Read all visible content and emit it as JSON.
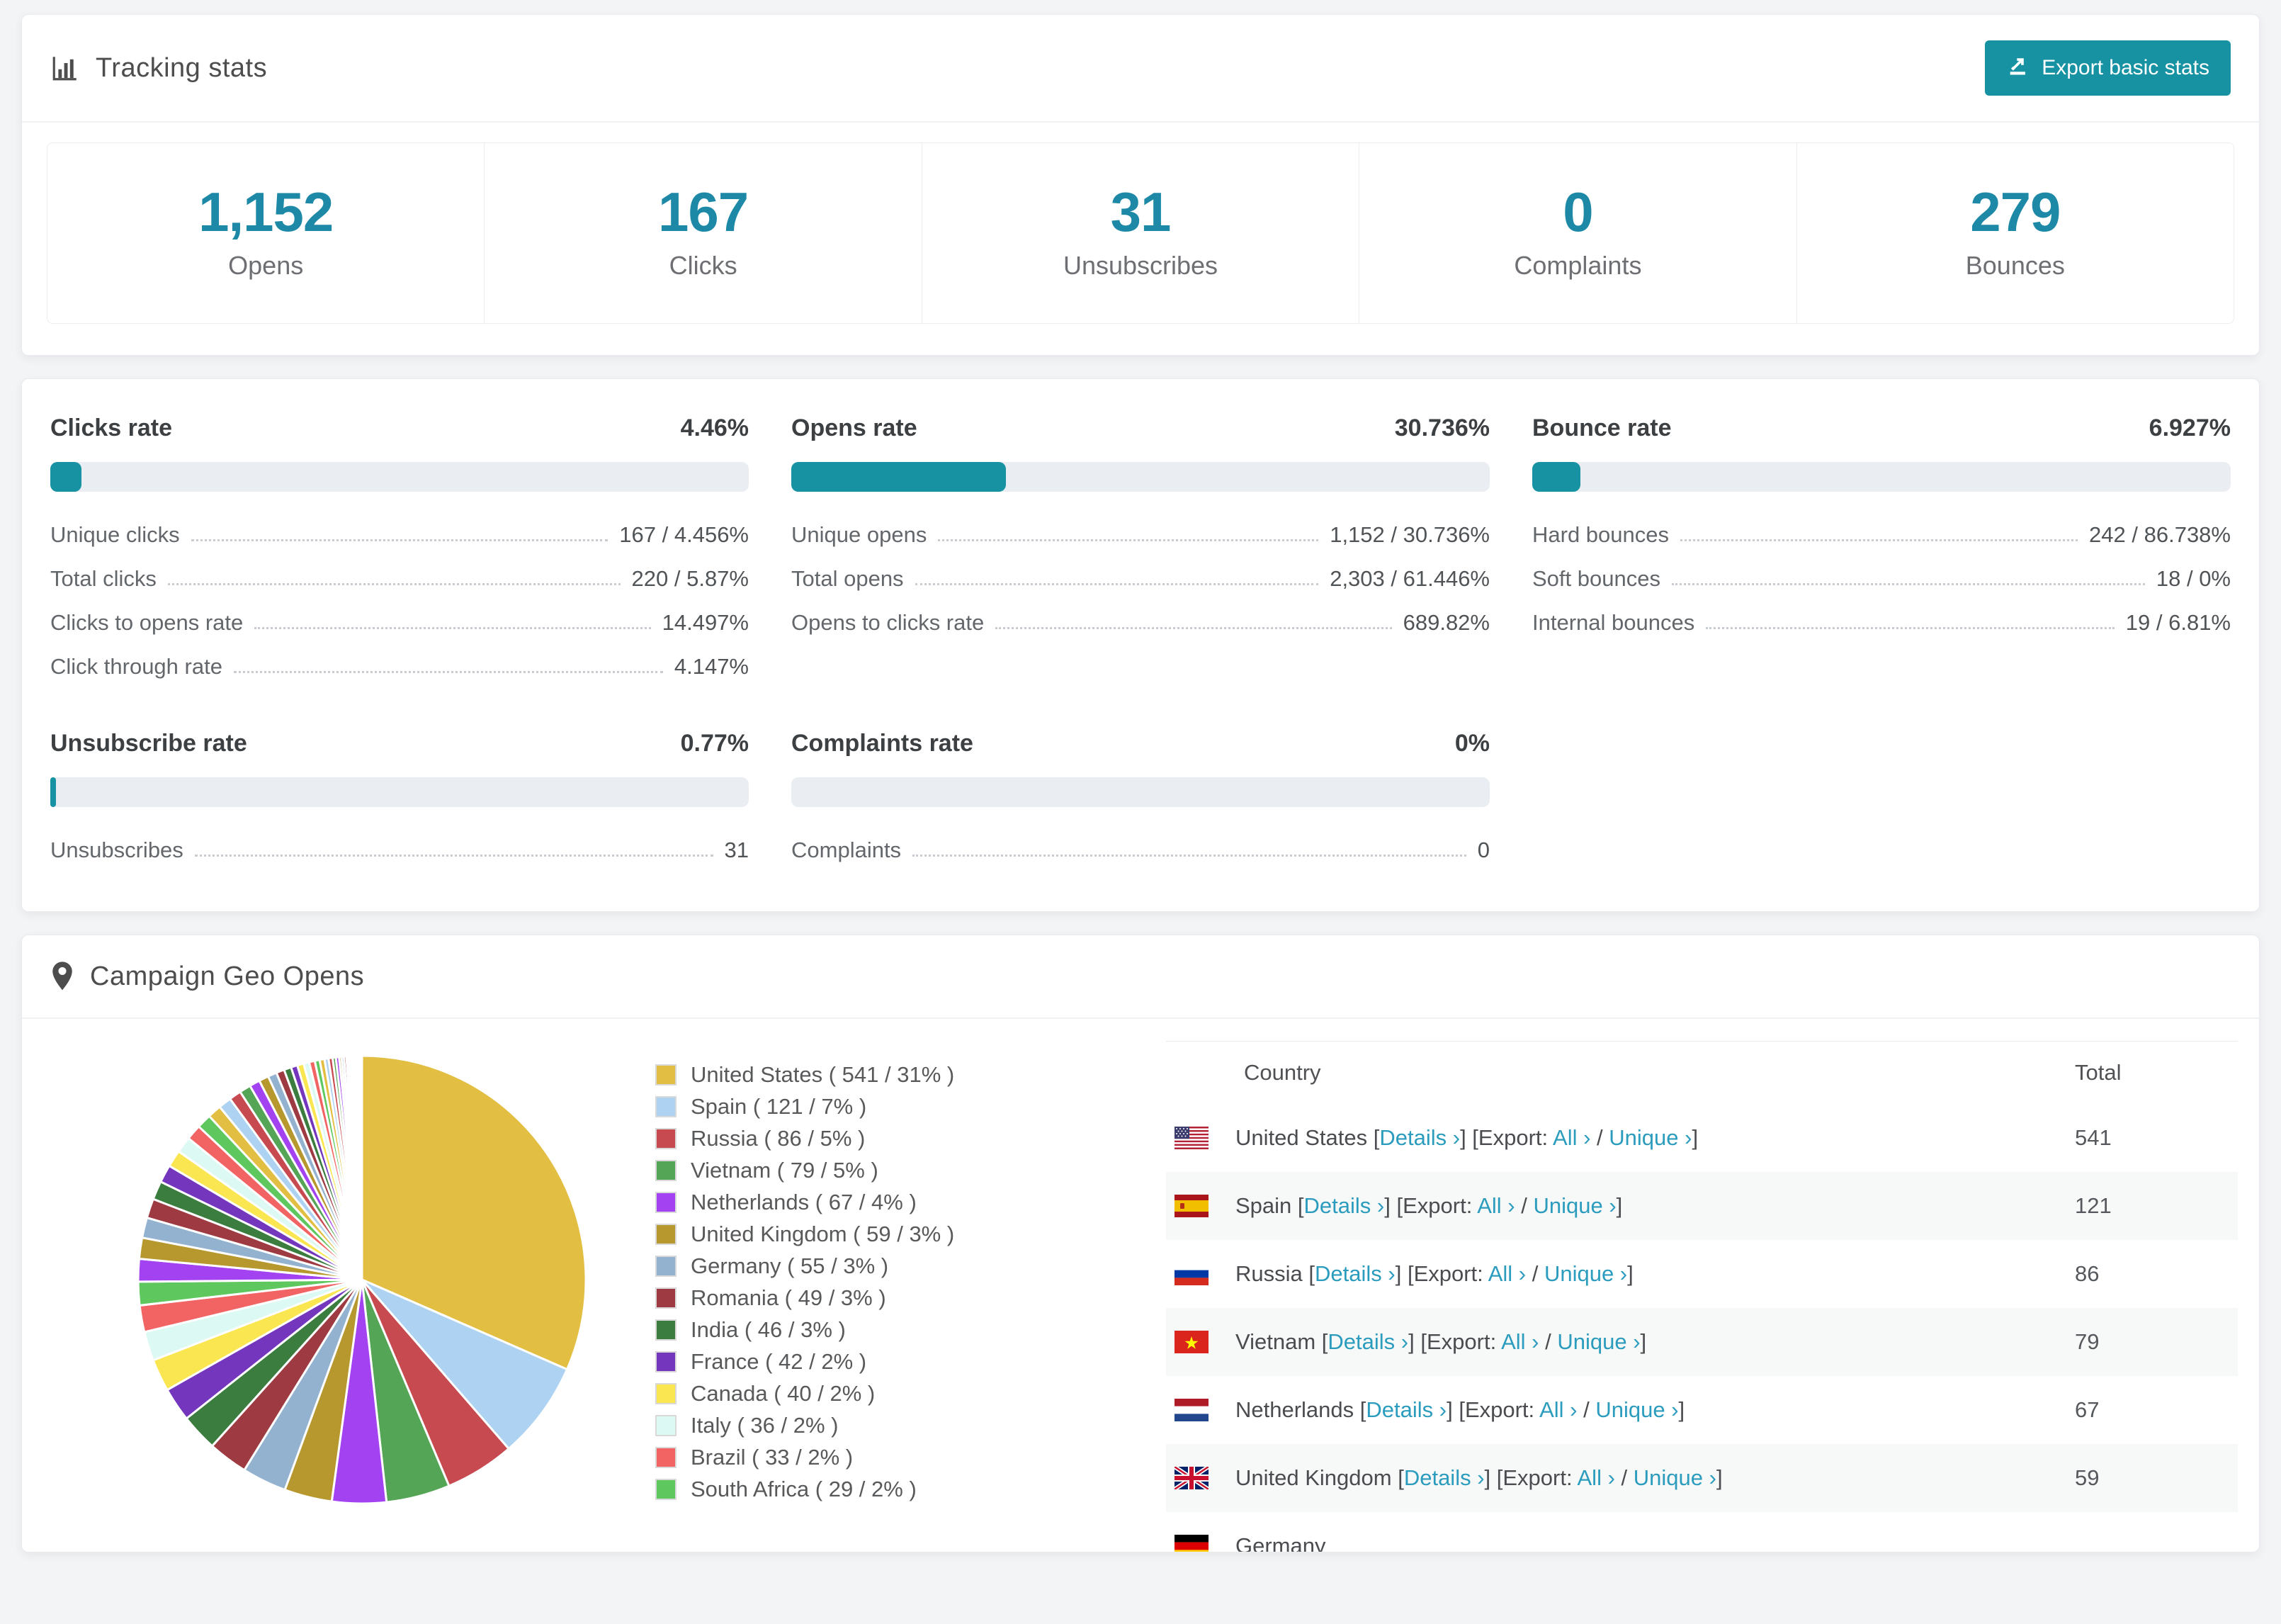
{
  "colors": {
    "accent": "#1692a2",
    "stat_number": "#1d89a6",
    "link": "#2b9cbd",
    "bar_track": "#eaedf1"
  },
  "tracking": {
    "title": "Tracking stats",
    "export_label": "Export basic stats",
    "stats": [
      {
        "value": "1,152",
        "label": "Opens"
      },
      {
        "value": "167",
        "label": "Clicks"
      },
      {
        "value": "31",
        "label": "Unsubscribes"
      },
      {
        "value": "0",
        "label": "Complaints"
      },
      {
        "value": "279",
        "label": "Bounces"
      }
    ]
  },
  "rates": [
    {
      "title": "Clicks rate",
      "value": "4.46%",
      "percent": 4.46,
      "rows": [
        {
          "label": "Unique clicks",
          "value": "167 / 4.456%"
        },
        {
          "label": "Total clicks",
          "value": "220 / 5.87%"
        },
        {
          "label": "Clicks to opens rate",
          "value": "14.497%"
        },
        {
          "label": "Click through rate",
          "value": "4.147%"
        }
      ]
    },
    {
      "title": "Opens rate",
      "value": "30.736%",
      "percent": 30.736,
      "rows": [
        {
          "label": "Unique opens",
          "value": "1,152 / 30.736%"
        },
        {
          "label": "Total opens",
          "value": "2,303 / 61.446%"
        },
        {
          "label": "Opens to clicks rate",
          "value": "689.82%"
        }
      ]
    },
    {
      "title": "Bounce rate",
      "value": "6.927%",
      "percent": 6.927,
      "rows": [
        {
          "label": "Hard bounces",
          "value": "242 / 86.738%"
        },
        {
          "label": "Soft bounces",
          "value": "18 / 0%"
        },
        {
          "label": "Internal bounces",
          "value": "19 / 6.81%"
        }
      ]
    },
    {
      "title": "Unsubscribe rate",
      "value": "0.77%",
      "percent": 0.77,
      "rows": [
        {
          "label": "Unsubscribes",
          "value": "31"
        }
      ]
    },
    {
      "title": "Complaints rate",
      "value": "0%",
      "percent": 0,
      "rows": [
        {
          "label": "Complaints",
          "value": "0"
        }
      ]
    }
  ],
  "geo": {
    "title": "Campaign Geo Opens",
    "legend": [
      {
        "label": "United States ( 541 / 31% )",
        "color": "#e2bf42"
      },
      {
        "label": "Spain ( 121 / 7% )",
        "color": "#aed3f2"
      },
      {
        "label": "Russia ( 86 / 5% )",
        "color": "#c64a50"
      },
      {
        "label": "Vietnam ( 79 / 5% )",
        "color": "#55a556"
      },
      {
        "label": "Netherlands ( 67 / 4% )",
        "color": "#a342f0"
      },
      {
        "label": "United Kingdom ( 59 / 3% )",
        "color": "#b7982e"
      },
      {
        "label": "Germany ( 55 / 3% )",
        "color": "#93b2cf"
      },
      {
        "label": "Romania ( 49 / 3% )",
        "color": "#9e3a41"
      },
      {
        "label": "India ( 46 / 3% )",
        "color": "#3b7d3f"
      },
      {
        "label": "France ( 42 / 2% )",
        "color": "#7336bd"
      },
      {
        "label": "Canada ( 40 / 2% )",
        "color": "#fae651"
      },
      {
        "label": "Italy ( 36 / 2% )",
        "color": "#dcf9f3"
      },
      {
        "label": "Brazil ( 33 / 2% )",
        "color": "#f26464"
      },
      {
        "label": "South Africa ( 29 / 2% )",
        "color": "#5ec75e"
      }
    ],
    "links": {
      "ob": "[",
      "details": "Details ›",
      "cb_ob": "] [",
      "export": "Export:",
      "all": "All ›",
      "slash": "/",
      "unique": "Unique ›",
      "cb": "]"
    },
    "table": {
      "headers": [
        "Country",
        "Total"
      ],
      "rows": [
        {
          "country": "United States",
          "total": "541"
        },
        {
          "country": "Spain",
          "total": "121"
        },
        {
          "country": "Russia",
          "total": "86"
        },
        {
          "country": "Vietnam",
          "total": "79"
        },
        {
          "country": "Netherlands",
          "total": "67"
        },
        {
          "country": "United Kingdom",
          "total": "59"
        },
        {
          "country": "Germany",
          "total": ""
        }
      ]
    }
  },
  "chart_data": {
    "type": "pie",
    "title": "Campaign Geo Opens",
    "legend_position": "right",
    "start_angle_deg": -90,
    "slices": [
      {
        "label": "United States",
        "value": 541,
        "pct": "31%",
        "color": "#e2bf42"
      },
      {
        "label": "Spain",
        "value": 121,
        "pct": "7%",
        "color": "#aed3f2"
      },
      {
        "label": "Russia",
        "value": 86,
        "pct": "5%",
        "color": "#c64a50"
      },
      {
        "label": "Vietnam",
        "value": 79,
        "pct": "5%",
        "color": "#55a556"
      },
      {
        "label": "Netherlands",
        "value": 67,
        "pct": "4%",
        "color": "#a342f0"
      },
      {
        "label": "United Kingdom",
        "value": 59,
        "pct": "3%",
        "color": "#b7982e"
      },
      {
        "label": "Germany",
        "value": 55,
        "pct": "3%",
        "color": "#93b2cf"
      },
      {
        "label": "Romania",
        "value": 49,
        "pct": "3%",
        "color": "#9e3a41"
      },
      {
        "label": "India",
        "value": 46,
        "pct": "3%",
        "color": "#3b7d3f"
      },
      {
        "label": "France",
        "value": 42,
        "pct": "2%",
        "color": "#7336bd"
      },
      {
        "label": "Canada",
        "value": 40,
        "pct": "2%",
        "color": "#fae651"
      },
      {
        "label": "Italy",
        "value": 36,
        "pct": "2%",
        "color": "#dcf9f3"
      },
      {
        "label": "Brazil",
        "value": 33,
        "pct": "2%",
        "color": "#f26464"
      },
      {
        "label": "South Africa",
        "value": 29,
        "pct": "2%",
        "color": "#5ec75e"
      }
    ],
    "other_values": [
      28,
      26,
      25,
      24,
      23,
      22,
      21,
      20,
      19,
      18,
      17,
      16,
      15,
      14,
      13,
      12,
      11,
      10,
      9,
      8,
      8,
      7,
      7,
      6,
      6,
      5,
      5,
      4,
      4,
      3,
      3,
      3,
      2,
      2,
      2,
      2,
      2,
      1,
      1,
      1,
      1,
      1,
      1,
      1,
      1,
      1
    ],
    "palette": [
      "#e2bf42",
      "#aed3f2",
      "#c64a50",
      "#55a556",
      "#a342f0",
      "#b7982e",
      "#93b2cf",
      "#9e3a41",
      "#3b7d3f",
      "#7336bd",
      "#fae651",
      "#dcf9f3",
      "#f26464",
      "#5ec75e"
    ]
  }
}
